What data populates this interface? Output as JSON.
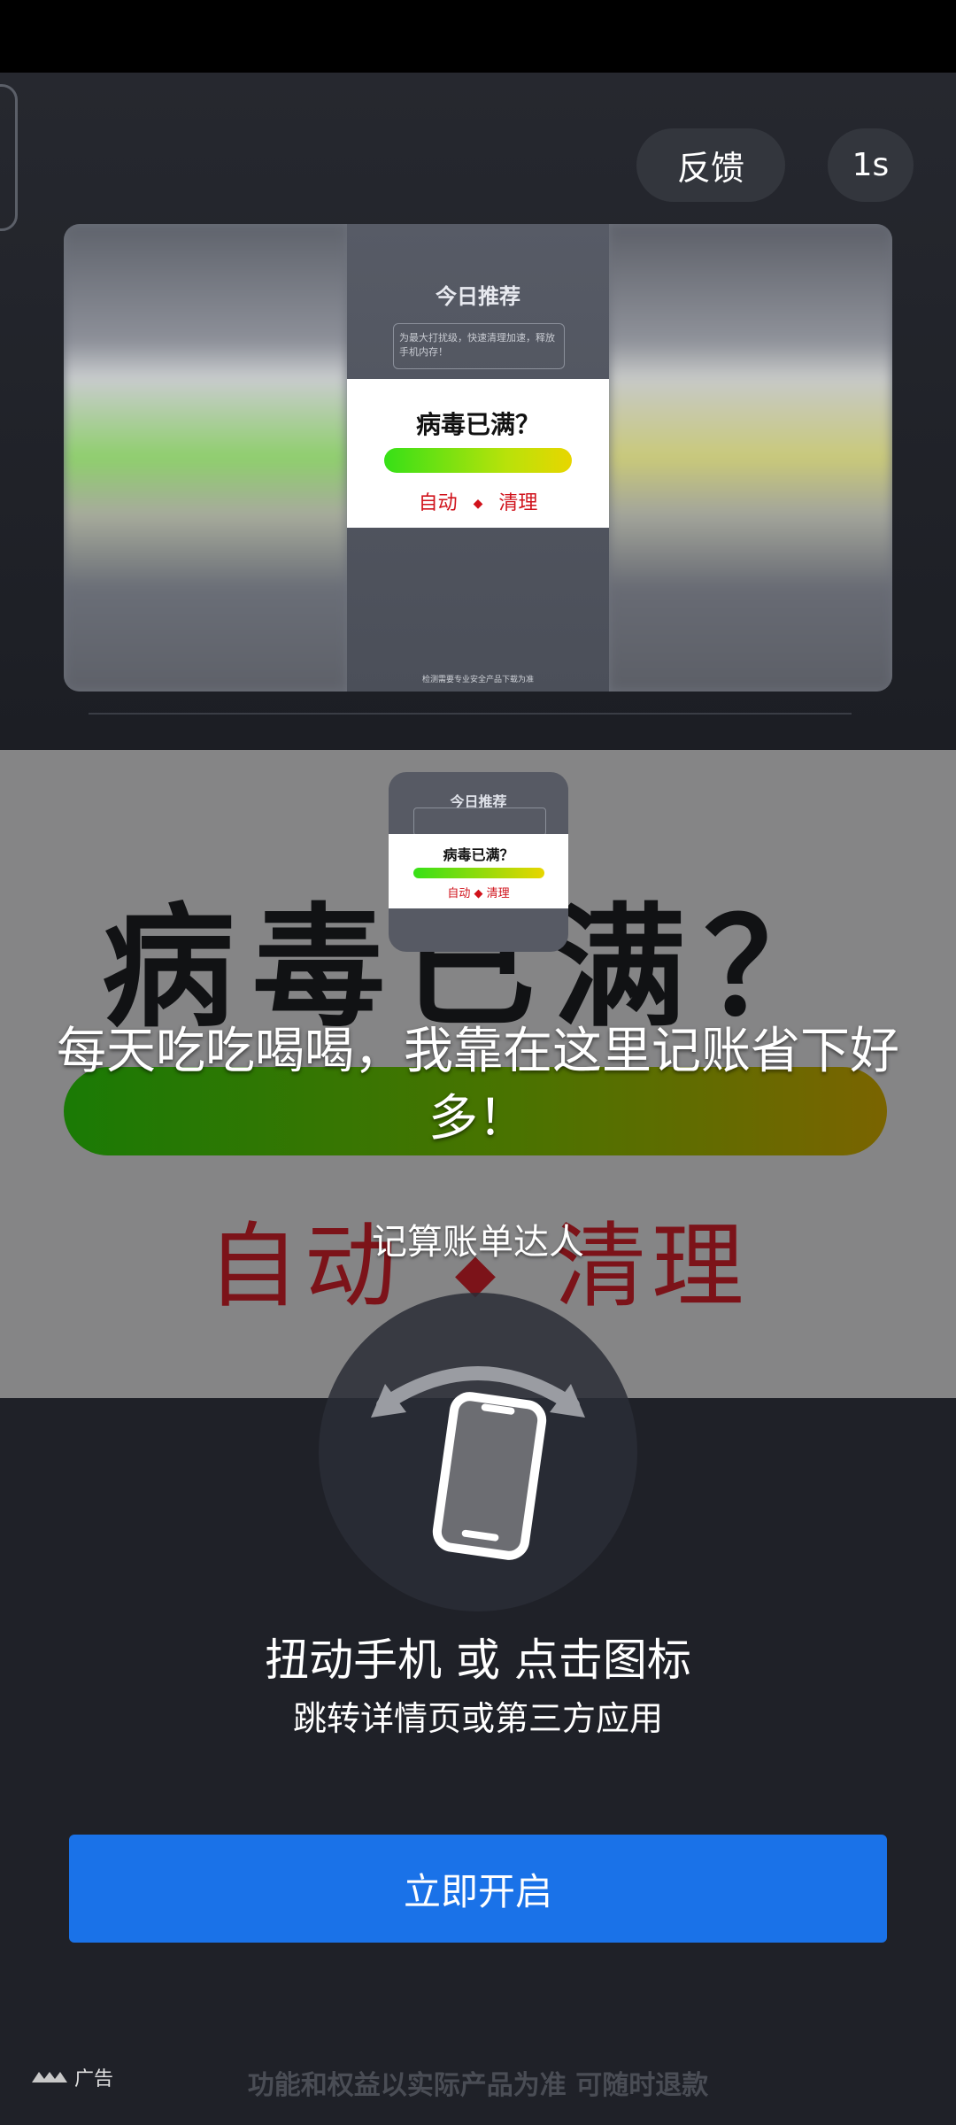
{
  "header": {
    "feedback_label": "反馈",
    "countdown": "1s"
  },
  "preview": {
    "logo": "今日推荐",
    "box_text": "为最大打扰级，快速清理加速，释放手机内存！",
    "headline": "病毒已满？",
    "left_word": "自动",
    "right_word": "清理",
    "footer": "检测需要专业安全产品下载为准"
  },
  "background_creative": {
    "headline": "病毒已满？",
    "left_word": "自动",
    "right_word": "清理"
  },
  "ad": {
    "title": "每天吃吃喝喝，我靠在这里记账省下好多！",
    "app_name": "记算账单达人"
  },
  "shake": {
    "icon": "shake-phone-icon",
    "title": "扭动手机 或 点击图标",
    "subtitle": "跳转详情页或第三方应用"
  },
  "cta": {
    "label": "立即开启",
    "color": "#1a72e8"
  },
  "footer": {
    "ad_tag": "广告",
    "disclaimer": "功能和权益以实际产品为准 可随时退款"
  }
}
